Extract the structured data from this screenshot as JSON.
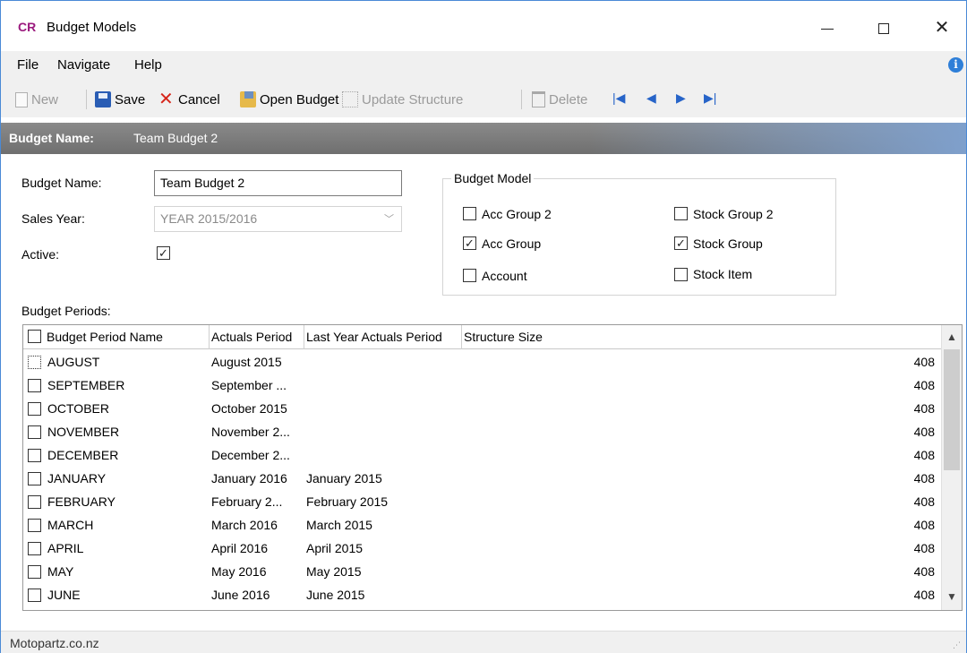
{
  "window": {
    "logo": "CR",
    "title": "Budget Models"
  },
  "menu": {
    "items": [
      {
        "label": "File"
      },
      {
        "label": "Navigate"
      },
      {
        "label": "Help"
      }
    ]
  },
  "toolbar": {
    "new_label": "New",
    "save_label": "Save",
    "cancel_label": "Cancel",
    "open_budget_label": "Open Budget",
    "update_structure_label": "Update Structure",
    "delete_label": "Delete"
  },
  "header": {
    "label": "Budget Name:",
    "value": "Team Budget 2"
  },
  "form": {
    "budget_name_label": "Budget Name:",
    "budget_name_value": "Team Budget 2",
    "sales_year_label": "Sales Year:",
    "sales_year_value": "YEAR 2015/2016",
    "active_label": "Active:",
    "active_checked": true
  },
  "budget_model": {
    "title": "Budget Model",
    "options": [
      {
        "label": "Acc Group 2",
        "checked": false
      },
      {
        "label": "Stock Group 2",
        "checked": false
      },
      {
        "label": "Acc Group",
        "checked": true
      },
      {
        "label": "Stock Group",
        "checked": true
      },
      {
        "label": "Account",
        "checked": false
      },
      {
        "label": "Stock Item",
        "checked": false
      }
    ]
  },
  "periods": {
    "label": "Budget Periods:",
    "columns": [
      "Budget Period Name",
      "Actuals Period",
      "Last Year Actuals Period",
      "Structure Size"
    ],
    "rows": [
      {
        "name": "AUGUST",
        "actuals": "August 2015",
        "last_year": "",
        "size": "408"
      },
      {
        "name": "SEPTEMBER",
        "actuals": "September ...",
        "last_year": "",
        "size": "408"
      },
      {
        "name": "OCTOBER",
        "actuals": "October 2015",
        "last_year": "",
        "size": "408"
      },
      {
        "name": "NOVEMBER",
        "actuals": "November 2...",
        "last_year": "",
        "size": "408"
      },
      {
        "name": "DECEMBER",
        "actuals": "December 2...",
        "last_year": "",
        "size": "408"
      },
      {
        "name": "JANUARY",
        "actuals": "January 2016",
        "last_year": "January 2015",
        "size": "408"
      },
      {
        "name": "FEBRUARY",
        "actuals": "February 2...",
        "last_year": "February 2015",
        "size": "408"
      },
      {
        "name": "MARCH",
        "actuals": "March 2016",
        "last_year": "March 2015",
        "size": "408"
      },
      {
        "name": "APRIL",
        "actuals": "April 2016",
        "last_year": "April 2015",
        "size": "408"
      },
      {
        "name": "MAY",
        "actuals": "May 2016",
        "last_year": "May 2015",
        "size": "408"
      },
      {
        "name": "JUNE",
        "actuals": "June 2016",
        "last_year": "June 2015",
        "size": "408"
      }
    ]
  },
  "status": {
    "text": "Motopartz.co.nz"
  }
}
